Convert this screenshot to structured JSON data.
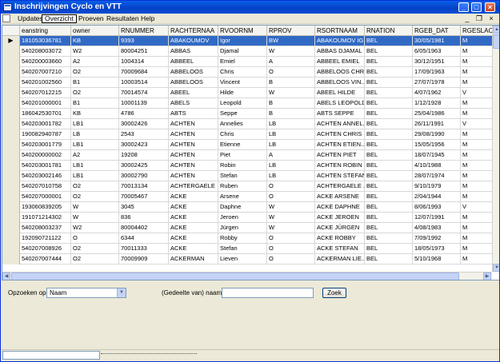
{
  "window": {
    "title": "Inschrijvingen Cyclo en VTT"
  },
  "menu": {
    "items": [
      "Updates",
      "Overzicht",
      "Proeven",
      "Resultaten",
      "Help"
    ],
    "active": "Overzicht"
  },
  "grid": {
    "columns": [
      "eanstring",
      "owner",
      "RNUMMER",
      "RACHTERNAA",
      "RVOORNM",
      "RPROV",
      "RSORTNAAM",
      "RNATION",
      "RGEB_DAT",
      "RGESLACH"
    ],
    "selected_row": 0,
    "rows": [
      [
        "181053036781",
        "KB",
        "9393",
        "ABAKOUMOV",
        "Igor",
        "BW",
        "ABAKOUMOV IG...",
        "BEL",
        "30/05/1981",
        "M"
      ],
      [
        "540208003072",
        "W2",
        "80004251",
        "ABBAS",
        "Djamal",
        "W",
        "ABBAS DJAMAL",
        "BEL",
        "6/05/1963",
        "M"
      ],
      [
        "540200003660",
        "A2",
        "1004314",
        "ABBEEL",
        "Emiel",
        "A",
        "ABBEEL EMIEL",
        "BEL",
        "30/12/1951",
        "M"
      ],
      [
        "540207007210",
        "O2",
        "70009684",
        "ABBELOOS",
        "Chris",
        "O",
        "ABBELOOS CHR...",
        "BEL",
        "17/09/1963",
        "M"
      ],
      [
        "540201002560",
        "B1",
        "10003514",
        "ABBELOOS",
        "Vincent",
        "B",
        "ABBELOOS VIN...",
        "BEL",
        "27/07/1978",
        "M"
      ],
      [
        "540207012215",
        "O2",
        "70014574",
        "ABEEL",
        "Hilde",
        "W",
        "ABEEL HILDE",
        "BEL",
        "4/07/1962",
        "V"
      ],
      [
        "540201000001",
        "B1",
        "10001139",
        "ABELS",
        "Leopold",
        "B",
        "ABELS LEOPOLD",
        "BEL",
        "1/12/1928",
        "M"
      ],
      [
        "186042530701",
        "KB",
        "4786",
        "ABTS",
        "Seppe",
        "B",
        "ABTS SEPPE",
        "BEL",
        "25/04/1986",
        "M"
      ],
      [
        "540203001782",
        "LB1",
        "30002426",
        "ACHTEN",
        "Annelies",
        "LB",
        "ACHTEN ANNEL...",
        "BEL",
        "26/11/1991",
        "V"
      ],
      [
        "190082940787",
        "LB",
        "2543",
        "ACHTEN",
        "Chris",
        "LB",
        "ACHTEN CHRIS",
        "BEL",
        "29/08/1990",
        "M"
      ],
      [
        "540203001779",
        "LB1",
        "30002423",
        "ACHTEN",
        "Etienne",
        "LB",
        "ACHTEN ETIEN...",
        "BEL",
        "15/05/1956",
        "M"
      ],
      [
        "540200000002",
        "A2",
        "19208",
        "ACHTEN",
        "Piet",
        "A",
        "ACHTEN PIET",
        "BEL",
        "18/07/1945",
        "M"
      ],
      [
        "540203001781",
        "LB1",
        "30002425",
        "ACHTEN",
        "Robin",
        "LB",
        "ACHTEN ROBIN",
        "BEL",
        "4/10/1988",
        "M"
      ],
      [
        "540203002146",
        "LB1",
        "30002790",
        "ACHTEN",
        "Stefan",
        "LB",
        "ACHTEN STEFAN",
        "BEL",
        "28/07/1974",
        "M"
      ],
      [
        "540207010758",
        "O2",
        "70013134",
        "ACHTERGAELE",
        "Ruben",
        "O",
        "ACHTERGAELE ...",
        "BEL",
        "9/10/1979",
        "M"
      ],
      [
        "540207000001",
        "O2",
        "70005467",
        "ACKE",
        "Arsene",
        "O",
        "ACKE ARSENE",
        "BEL",
        "2/04/1944",
        "M"
      ],
      [
        "193060839205",
        "W",
        "3045",
        "ACKE",
        "Daphne",
        "W",
        "ACKE DAPHNE",
        "BEL",
        "8/06/1993",
        "V"
      ],
      [
        "191071214302",
        "W",
        "836",
        "ACKE",
        "Jeroen",
        "W",
        "ACKE JEROEN",
        "BEL",
        "12/07/1991",
        "M"
      ],
      [
        "540208003237",
        "W2",
        "80004402",
        "ACKE",
        "Jürgen",
        "W",
        "ACKE JÜRGEN",
        "BEL",
        "4/08/1983",
        "M"
      ],
      [
        "192090721122",
        "O",
        "6344",
        "ACKE",
        "Robby",
        "O",
        "ACKE ROBBY",
        "BEL",
        "7/09/1992",
        "M"
      ],
      [
        "540207008926",
        "O2",
        "70011333",
        "ACKE",
        "Stefan",
        "O",
        "ACKE STEFAN",
        "BEL",
        "18/05/1973",
        "M"
      ],
      [
        "540207007444",
        "O2",
        "70009909",
        "ACKERMAN",
        "Lieven",
        "O",
        "ACKERMAN LIE...",
        "BEL",
        "5/10/1968",
        "M"
      ]
    ]
  },
  "search": {
    "label": "Opzoeken op:",
    "field": "Naam",
    "query_label": "(Gedeelte van) naam:*",
    "query_value": "",
    "button": "Zoek"
  },
  "icons": {
    "row_pointer": "▶",
    "scroll_up": "▲",
    "scroll_down": "▼",
    "scroll_left": "◀",
    "scroll_right": "▶",
    "dropdown": "▼",
    "minimize": "_",
    "maximize": "□",
    "close": "×",
    "mdi_minimize": "_",
    "mdi_restore": "❐",
    "mdi_close": "×"
  }
}
